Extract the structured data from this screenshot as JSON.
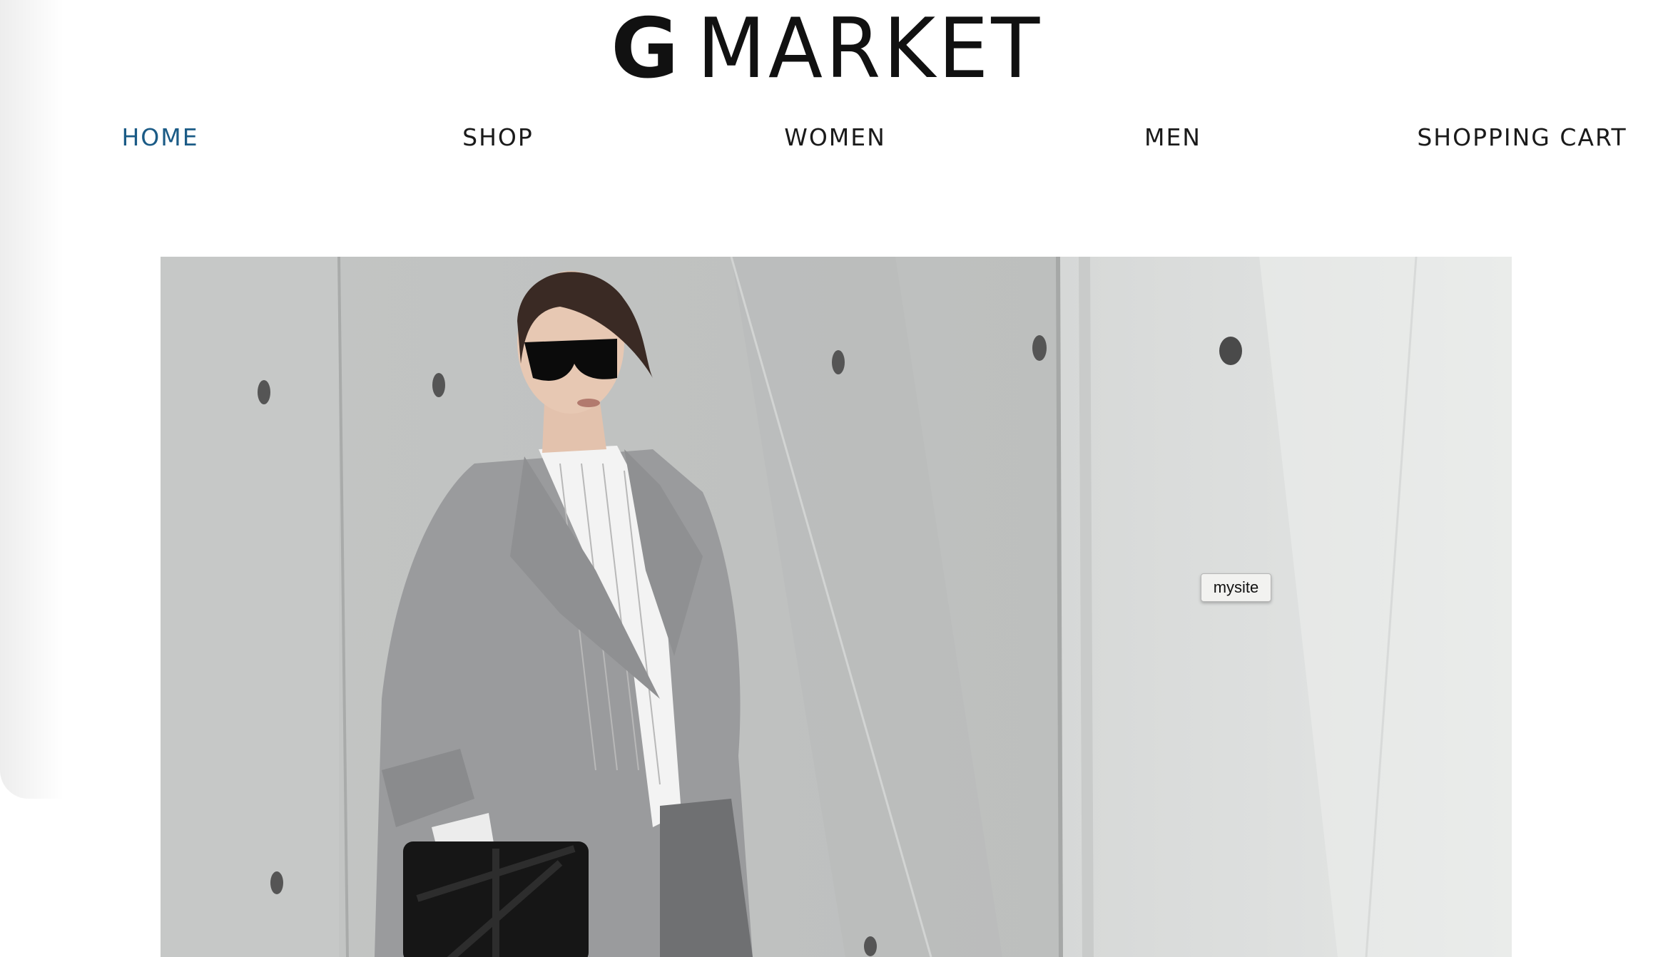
{
  "logo": {
    "initial": "G",
    "word": "MARKET"
  },
  "nav": {
    "items": [
      {
        "label": "HOME",
        "active": true
      },
      {
        "label": "SHOP",
        "active": false
      },
      {
        "label": "WOMEN",
        "active": false
      },
      {
        "label": "MEN",
        "active": false
      },
      {
        "label": "SHOPPING CART",
        "active": false
      }
    ]
  },
  "colors": {
    "nav_active": "#1b5b86",
    "nav_text": "#1a1a1a",
    "logo": "#111111"
  },
  "tooltip": {
    "text": "mysite"
  }
}
